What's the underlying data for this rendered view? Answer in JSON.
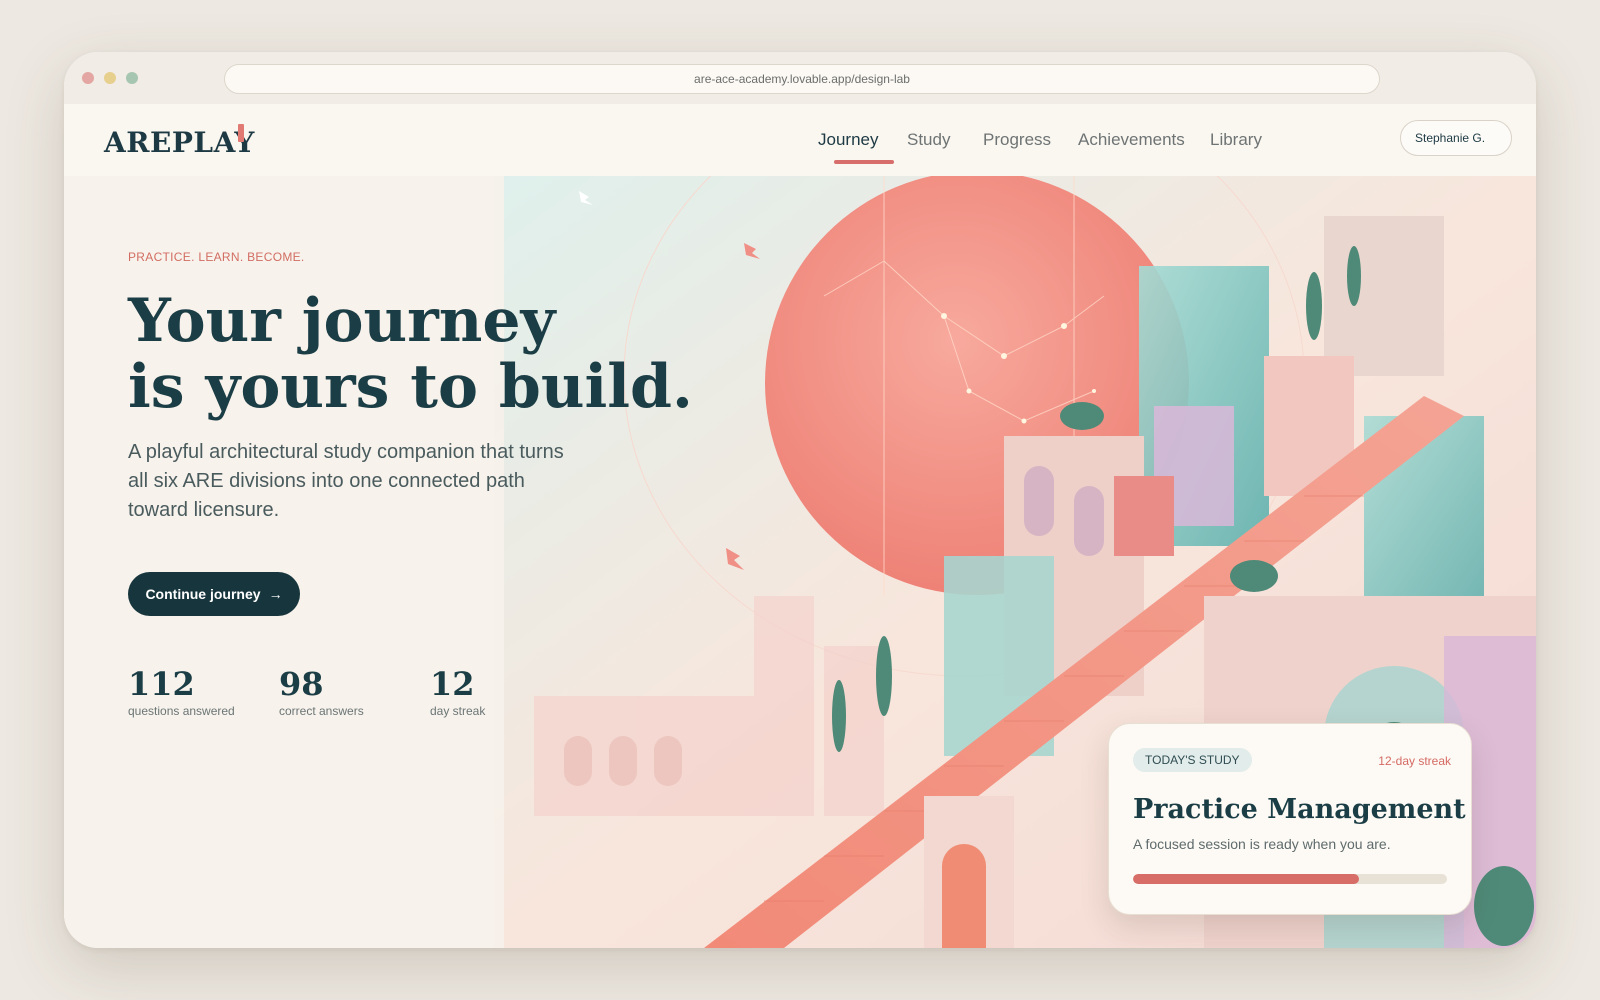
{
  "browser": {
    "url": "are-ace-academy.lovable.app/design-lab"
  },
  "header": {
    "logo": "AREPLAY",
    "nav": [
      {
        "label": "Journey",
        "active": true
      },
      {
        "label": "Study",
        "active": false
      },
      {
        "label": "Progress",
        "active": false
      },
      {
        "label": "Achievements",
        "active": false
      },
      {
        "label": "Library",
        "active": false
      }
    ],
    "user": "Stephanie G."
  },
  "hero": {
    "eyebrow": "PRACTICE. LEARN. BECOME.",
    "title_line1": "Your journey",
    "title_line2": "is yours to build.",
    "subtitle": "A playful architectural study companion that turns all six ARE divisions into one connected path toward licensure.",
    "cta_label": "Continue journey",
    "cta_icon": "arrow-right-icon",
    "stats": [
      {
        "value": "112",
        "label": "questions answered"
      },
      {
        "value": "98",
        "label": "correct answers"
      },
      {
        "value": "12",
        "label": "day streak"
      }
    ]
  },
  "study_card": {
    "badge": "TODAY'S STUDY",
    "streak": "12-day streak",
    "title": "Practice Management",
    "subtitle": "A focused session is ready when you are.",
    "progress": 0.72
  },
  "colors": {
    "accent": "#d86d67",
    "primary_dark": "#17353d",
    "sun": "#f4958a",
    "glass": "#8fcfc8"
  }
}
